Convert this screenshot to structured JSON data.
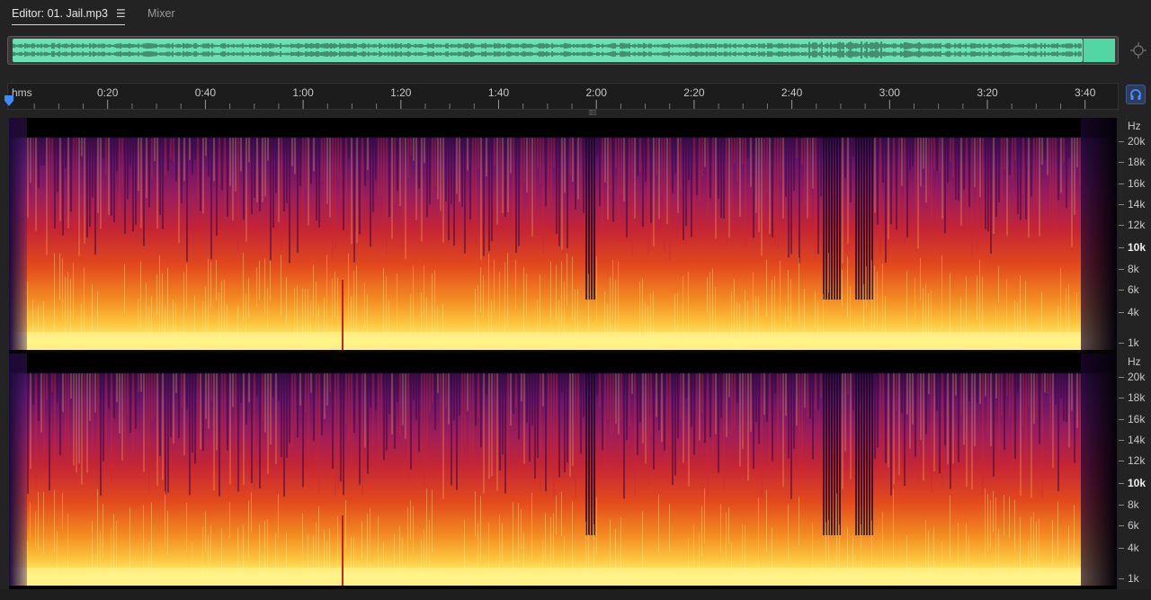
{
  "tabs": {
    "editor_label": "Editor: 01. Jail.mp3",
    "editor_menu_glyph": "☰",
    "mixer_label": "Mixer"
  },
  "ruler": {
    "units": "hms",
    "ticks": [
      "0:20",
      "0:40",
      "1:00",
      "1:20",
      "1:40",
      "2:00",
      "2:20",
      "2:40",
      "3:00",
      "3:20",
      "3:40"
    ]
  },
  "frequency_axis": {
    "unit": "Hz",
    "channel1_labels": [
      "20k",
      "18k",
      "16k",
      "14k",
      "12k",
      "10k",
      "8k",
      "6k",
      "4k",
      "1k"
    ],
    "channel2_labels": [
      "20k",
      "18k",
      "16k",
      "14k",
      "12k",
      "10k",
      "8k",
      "6k",
      "4k",
      "1k"
    ],
    "bold_label": "10k"
  },
  "icons": {
    "zoom": "zoom-target-icon",
    "headphones": "headphones-icon",
    "playhead": "playhead-marker-icon"
  },
  "colors": {
    "overview_waveform": "#6ae3b4",
    "accent_blue": "#4d8dff",
    "spectrogram_hot": "#fff27a",
    "spectrogram_mid": "#c42534",
    "spectrogram_cool": "#6a1668"
  }
}
